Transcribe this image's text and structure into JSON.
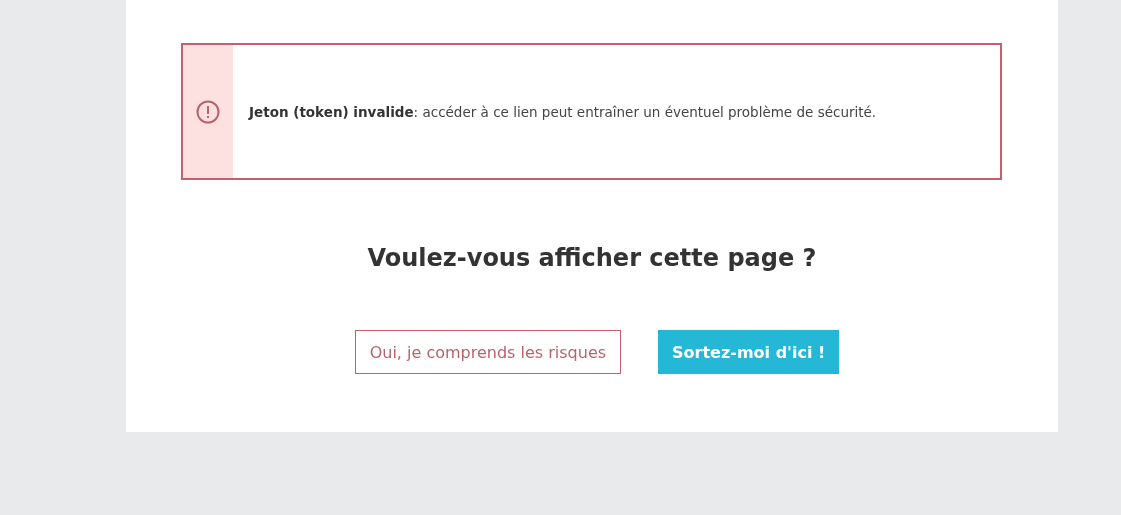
{
  "alert": {
    "message": "**Jeton (token) invalide**: accéder à ce lien peut entraîner un éventuel problème de sécurité."
  },
  "question": "Voulez-vous afficher cette page ?",
  "buttons": [
    {
      "label": "Oui, je comprends les risques",
      "kind": "outline"
    },
    {
      "label": "Sortez-moi d'ici !",
      "kind": "primary"
    }
  ]
}
